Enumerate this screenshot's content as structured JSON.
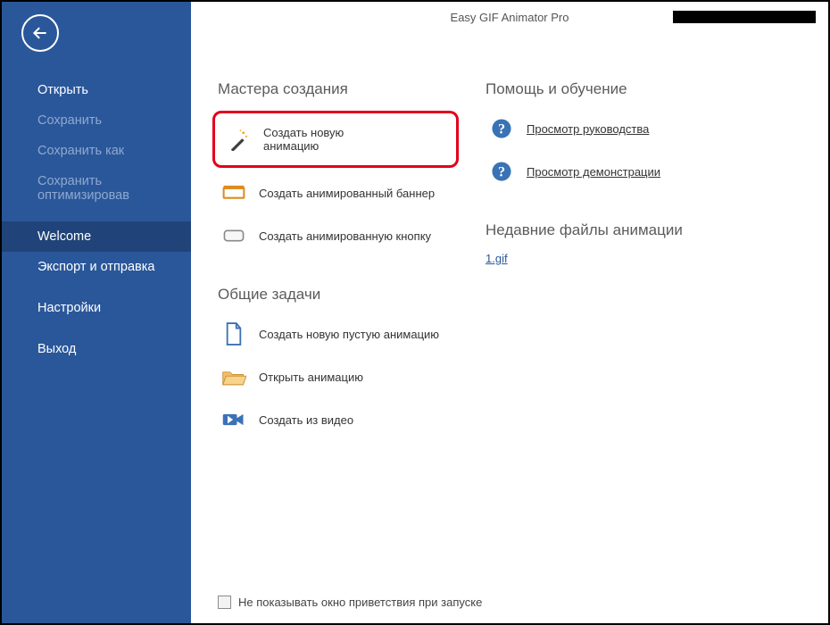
{
  "title": "Easy GIF Animator Pro",
  "sidebar": {
    "items": [
      {
        "label": "Открыть",
        "disabled": false,
        "active": false
      },
      {
        "label": "Сохранить",
        "disabled": true,
        "active": false
      },
      {
        "label": "Сохранить как",
        "disabled": true,
        "active": false
      },
      {
        "label": "Сохранить оптимизировав",
        "disabled": true,
        "active": false
      },
      {
        "label": "Welcome",
        "disabled": false,
        "active": true
      },
      {
        "label": "Экспорт и отправка",
        "disabled": false,
        "active": false
      },
      {
        "label": "Настройки",
        "disabled": false,
        "active": false
      },
      {
        "label": "Выход",
        "disabled": false,
        "active": false
      }
    ]
  },
  "sections": {
    "wizards_title": "Мастера создания",
    "help_title": "Помощь и обучение",
    "common_title": "Общие задачи",
    "recent_title": "Недавние файлы анимации"
  },
  "wizards": {
    "new_anim": "Создать новую анимацию",
    "banner": "Создать анимированный баннер",
    "button": "Создать анимированную кнопку"
  },
  "help": {
    "guide": "Просмотр руководства",
    "demo": "Просмотр демонстрации"
  },
  "common": {
    "new_empty": "Создать новую пустую анимацию",
    "open": "Открыть анимацию",
    "from_video": "Создать из видео"
  },
  "recent_files": [
    "1.gif"
  ],
  "footer": {
    "dont_show": "Не показывать окно приветствия при запуске"
  }
}
